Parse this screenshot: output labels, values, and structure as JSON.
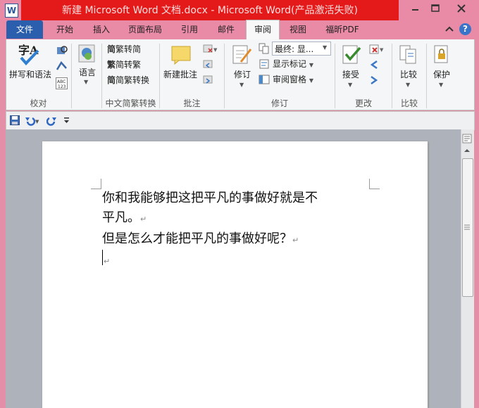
{
  "window": {
    "title": "新建 Microsoft Word 文档.docx - Microsoft Word(产品激活失败)",
    "logo_letter": "W"
  },
  "tabs": [
    {
      "label": "文件"
    },
    {
      "label": "开始"
    },
    {
      "label": "插入"
    },
    {
      "label": "页面布局"
    },
    {
      "label": "引用"
    },
    {
      "label": "邮件"
    },
    {
      "label": "审阅"
    },
    {
      "label": "视图"
    },
    {
      "label": "福昕PDF"
    }
  ],
  "help_glyph": "?",
  "ribbon": {
    "groups": {
      "proofing": "校对",
      "chinese_conversion": "中文简繁转换",
      "comments": "批注",
      "tracking": "修订",
      "changes": "更改",
      "compare": "比较"
    },
    "buttons": {
      "spelling": "拼写和语法",
      "spelling_icon_text": "字A",
      "abc_badge": "ABC\n123",
      "language": "语言",
      "to_traditional_icon": "简",
      "to_simplified_icon": "繁",
      "conversion_icon": "简",
      "to_traditional": "繁转简",
      "to_simplified": "简转繁",
      "conversion": "简繁转换",
      "new_comment": "新建批注",
      "track_changes": "修订",
      "display_mode": "最终: 显...",
      "show_markup": "显示标记",
      "reviewing_pane": "审阅窗格",
      "accept": "接受",
      "compare": "比较",
      "protect": "保护"
    }
  },
  "document": {
    "line1": "你和我能够把这把平凡的事做好就是不",
    "line2": "平凡。",
    "line3": "但是怎么才能把平凡的事做好呢？",
    "para_mark": "↵"
  },
  "colors": {
    "title_red": "#e41a1a",
    "file_tab": "#2b5fae",
    "frame_pink": "#e98aa6"
  }
}
